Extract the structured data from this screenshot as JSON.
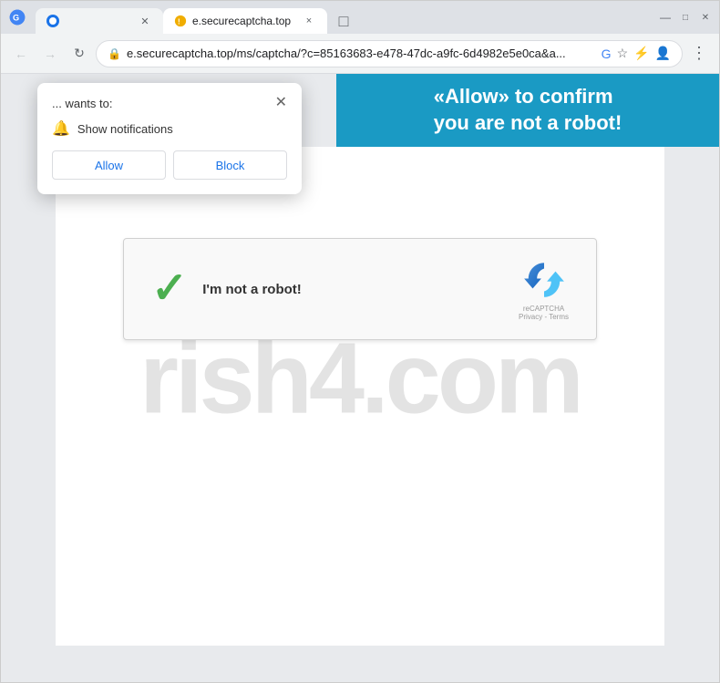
{
  "browser": {
    "title": "e.securecaptcha.top",
    "tab": {
      "label": "e.securecaptcha.top",
      "close_label": "×"
    },
    "new_tab_icon": "+",
    "window_controls": {
      "minimize": "—",
      "maximize": "□",
      "close": "✕"
    },
    "address_bar": {
      "url": "e.securecaptcha.top/ms/captcha/?c=85163683-e478-47dc-a9fc-6d4982e5e0ca&a...",
      "lock_icon": "🔒"
    }
  },
  "notification_popup": {
    "title": "... wants to:",
    "close_icon": "✕",
    "notification_row": {
      "bell_icon": "🔔",
      "text": "Show notifications"
    },
    "buttons": {
      "allow": "Allow",
      "block": "Block"
    }
  },
  "page": {
    "banner_line1": "«Allow» to confirm",
    "banner_line2": "you are not a robot!",
    "watermark": "rish4.com",
    "captcha_label": "I'm not a robot!",
    "checkmark": "✓"
  }
}
